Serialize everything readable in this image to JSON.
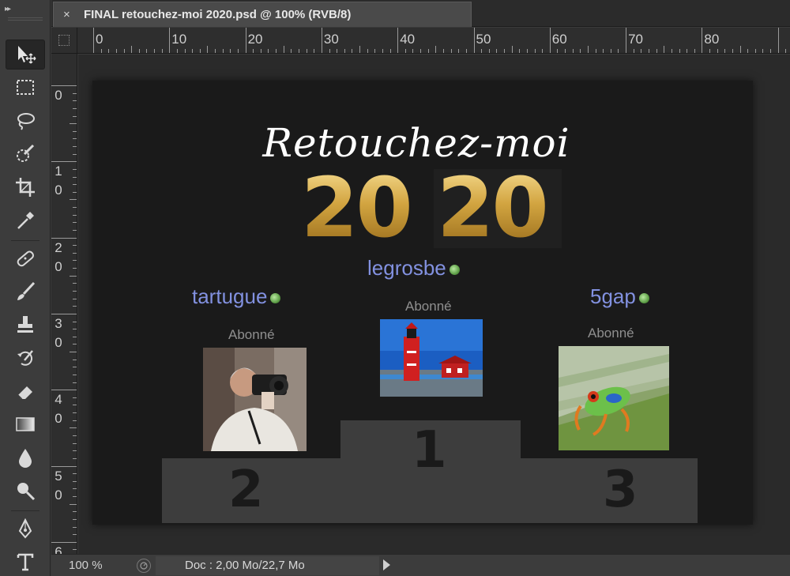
{
  "app": {
    "toolbar_collapse_glyph": "▸▸"
  },
  "tab": {
    "close_glyph": "×",
    "title": "FINAL retouchez-moi 2020.psd @ 100% (RVB/8)"
  },
  "ruler": {
    "top": [
      "0",
      "10",
      "20",
      "30",
      "40",
      "50",
      "60",
      "70",
      "80"
    ],
    "left": [
      [
        "0"
      ],
      [
        "1",
        "0"
      ],
      [
        "2",
        "0"
      ],
      [
        "3",
        "0"
      ],
      [
        "4",
        "0"
      ],
      [
        "5",
        "0"
      ],
      [
        "6"
      ]
    ]
  },
  "tools": [
    {
      "name": "move-tool-icon",
      "active": true
    },
    {
      "name": "marquee-tool-icon"
    },
    {
      "name": "lasso-tool-icon"
    },
    {
      "name": "quick-selection-tool-icon"
    },
    {
      "name": "crop-tool-icon"
    },
    {
      "name": "eyedropper-tool-icon"
    },
    {
      "name": "healing-brush-tool-icon"
    },
    {
      "name": "brush-tool-icon"
    },
    {
      "name": "clone-stamp-tool-icon"
    },
    {
      "name": "history-brush-tool-icon"
    },
    {
      "name": "eraser-tool-icon"
    },
    {
      "name": "gradient-tool-icon"
    },
    {
      "name": "blur-tool-icon"
    },
    {
      "name": "dodge-tool-icon"
    },
    {
      "name": "pen-tool-icon"
    },
    {
      "name": "type-tool-icon"
    }
  ],
  "document": {
    "script_title": "Retouchez-moi",
    "year_part1": "20",
    "year_part2": "20",
    "winners": {
      "first": {
        "name": "legrosbe",
        "status": "Abonné",
        "rank": "1"
      },
      "second": {
        "name": "tartugue",
        "status": "Abonné",
        "rank": "2"
      },
      "third": {
        "name": "5gap",
        "status": "Abonné",
        "rank": "3"
      }
    }
  },
  "status": {
    "zoom": "100 %",
    "doc_info": "Doc : 2,00 Mo/22,7 Mo"
  },
  "colors": {
    "accent_name": "#8291e0",
    "gold": "#d4a93c",
    "podium": "#3d3d3d"
  }
}
